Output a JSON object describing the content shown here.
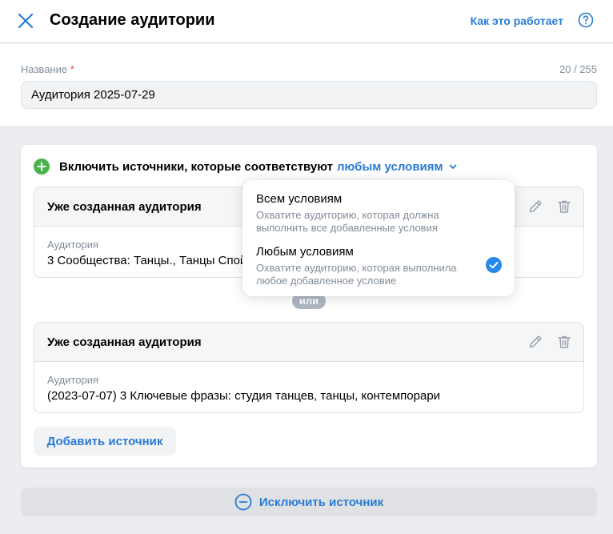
{
  "header": {
    "title": "Создание аудитории",
    "help_link": "Как это работает"
  },
  "name_field": {
    "label": "Название",
    "required_mark": "*",
    "counter": "20 / 255",
    "value": "Аудитория 2025-07-29"
  },
  "include": {
    "text": "Включить источники, которые соответствуют",
    "condition_link": "любым условиям"
  },
  "sources": [
    {
      "title": "Уже созданная аудитория",
      "label": "Аудитория",
      "value": "3 Сообщества: Танцы., Танцы Спой"
    },
    {
      "title": "Уже созданная аудитория",
      "label": "Аудитория",
      "value": "(2023-07-07) 3 Ключевые фразы: студия танцев, танцы, контемпорари"
    }
  ],
  "or_separator": "или",
  "add_source_label": "Добавить источник",
  "exclude_source_label": "Исключить источник",
  "dropdown": {
    "options": [
      {
        "title": "Всем условиям",
        "description": "Охватите аудиторию, которая должна выполнить все добавленные условия",
        "selected": false
      },
      {
        "title": "Любым условиям",
        "description": "Охватите аудиторию, которая выполнила любое добавленное условие",
        "selected": true
      }
    ]
  },
  "colors": {
    "accent": "#2a7bd3",
    "plus_green": "#4bb34b",
    "check_blue": "#2688eb",
    "muted_text": "#818c99",
    "page_bg": "#ebedf0"
  },
  "icons": {
    "close": "close-icon",
    "help": "question-circle-icon",
    "plus": "plus-circle-icon",
    "chevron": "chevron-down-icon",
    "edit": "pencil-icon",
    "delete": "trash-icon",
    "check": "check-circle-icon",
    "exclude": "minus-circle-icon"
  }
}
